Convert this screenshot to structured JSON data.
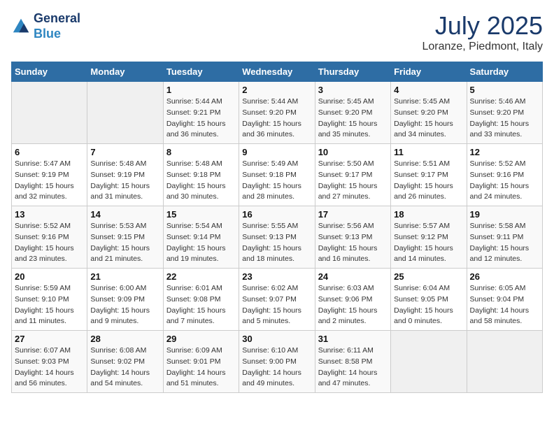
{
  "header": {
    "logo_line1": "General",
    "logo_line2": "Blue",
    "title": "July 2025",
    "subtitle": "Loranze, Piedmont, Italy"
  },
  "weekdays": [
    "Sunday",
    "Monday",
    "Tuesday",
    "Wednesday",
    "Thursday",
    "Friday",
    "Saturday"
  ],
  "weeks": [
    [
      {
        "day": "",
        "empty": true
      },
      {
        "day": "",
        "empty": true
      },
      {
        "day": "1",
        "sunrise": "5:44 AM",
        "sunset": "9:21 PM",
        "daylight": "15 hours and 36 minutes."
      },
      {
        "day": "2",
        "sunrise": "5:44 AM",
        "sunset": "9:20 PM",
        "daylight": "15 hours and 36 minutes."
      },
      {
        "day": "3",
        "sunrise": "5:45 AM",
        "sunset": "9:20 PM",
        "daylight": "15 hours and 35 minutes."
      },
      {
        "day": "4",
        "sunrise": "5:45 AM",
        "sunset": "9:20 PM",
        "daylight": "15 hours and 34 minutes."
      },
      {
        "day": "5",
        "sunrise": "5:46 AM",
        "sunset": "9:20 PM",
        "daylight": "15 hours and 33 minutes."
      }
    ],
    [
      {
        "day": "6",
        "sunrise": "5:47 AM",
        "sunset": "9:19 PM",
        "daylight": "15 hours and 32 minutes."
      },
      {
        "day": "7",
        "sunrise": "5:48 AM",
        "sunset": "9:19 PM",
        "daylight": "15 hours and 31 minutes."
      },
      {
        "day": "8",
        "sunrise": "5:48 AM",
        "sunset": "9:18 PM",
        "daylight": "15 hours and 30 minutes."
      },
      {
        "day": "9",
        "sunrise": "5:49 AM",
        "sunset": "9:18 PM",
        "daylight": "15 hours and 28 minutes."
      },
      {
        "day": "10",
        "sunrise": "5:50 AM",
        "sunset": "9:17 PM",
        "daylight": "15 hours and 27 minutes."
      },
      {
        "day": "11",
        "sunrise": "5:51 AM",
        "sunset": "9:17 PM",
        "daylight": "15 hours and 26 minutes."
      },
      {
        "day": "12",
        "sunrise": "5:52 AM",
        "sunset": "9:16 PM",
        "daylight": "15 hours and 24 minutes."
      }
    ],
    [
      {
        "day": "13",
        "sunrise": "5:52 AM",
        "sunset": "9:16 PM",
        "daylight": "15 hours and 23 minutes."
      },
      {
        "day": "14",
        "sunrise": "5:53 AM",
        "sunset": "9:15 PM",
        "daylight": "15 hours and 21 minutes."
      },
      {
        "day": "15",
        "sunrise": "5:54 AM",
        "sunset": "9:14 PM",
        "daylight": "15 hours and 19 minutes."
      },
      {
        "day": "16",
        "sunrise": "5:55 AM",
        "sunset": "9:13 PM",
        "daylight": "15 hours and 18 minutes."
      },
      {
        "day": "17",
        "sunrise": "5:56 AM",
        "sunset": "9:13 PM",
        "daylight": "15 hours and 16 minutes."
      },
      {
        "day": "18",
        "sunrise": "5:57 AM",
        "sunset": "9:12 PM",
        "daylight": "15 hours and 14 minutes."
      },
      {
        "day": "19",
        "sunrise": "5:58 AM",
        "sunset": "9:11 PM",
        "daylight": "15 hours and 12 minutes."
      }
    ],
    [
      {
        "day": "20",
        "sunrise": "5:59 AM",
        "sunset": "9:10 PM",
        "daylight": "15 hours and 11 minutes."
      },
      {
        "day": "21",
        "sunrise": "6:00 AM",
        "sunset": "9:09 PM",
        "daylight": "15 hours and 9 minutes."
      },
      {
        "day": "22",
        "sunrise": "6:01 AM",
        "sunset": "9:08 PM",
        "daylight": "15 hours and 7 minutes."
      },
      {
        "day": "23",
        "sunrise": "6:02 AM",
        "sunset": "9:07 PM",
        "daylight": "15 hours and 5 minutes."
      },
      {
        "day": "24",
        "sunrise": "6:03 AM",
        "sunset": "9:06 PM",
        "daylight": "15 hours and 2 minutes."
      },
      {
        "day": "25",
        "sunrise": "6:04 AM",
        "sunset": "9:05 PM",
        "daylight": "15 hours and 0 minutes."
      },
      {
        "day": "26",
        "sunrise": "6:05 AM",
        "sunset": "9:04 PM",
        "daylight": "14 hours and 58 minutes."
      }
    ],
    [
      {
        "day": "27",
        "sunrise": "6:07 AM",
        "sunset": "9:03 PM",
        "daylight": "14 hours and 56 minutes."
      },
      {
        "day": "28",
        "sunrise": "6:08 AM",
        "sunset": "9:02 PM",
        "daylight": "14 hours and 54 minutes."
      },
      {
        "day": "29",
        "sunrise": "6:09 AM",
        "sunset": "9:01 PM",
        "daylight": "14 hours and 51 minutes."
      },
      {
        "day": "30",
        "sunrise": "6:10 AM",
        "sunset": "9:00 PM",
        "daylight": "14 hours and 49 minutes."
      },
      {
        "day": "31",
        "sunrise": "6:11 AM",
        "sunset": "8:58 PM",
        "daylight": "14 hours and 47 minutes."
      },
      {
        "day": "",
        "empty": true
      },
      {
        "day": "",
        "empty": true
      }
    ]
  ]
}
